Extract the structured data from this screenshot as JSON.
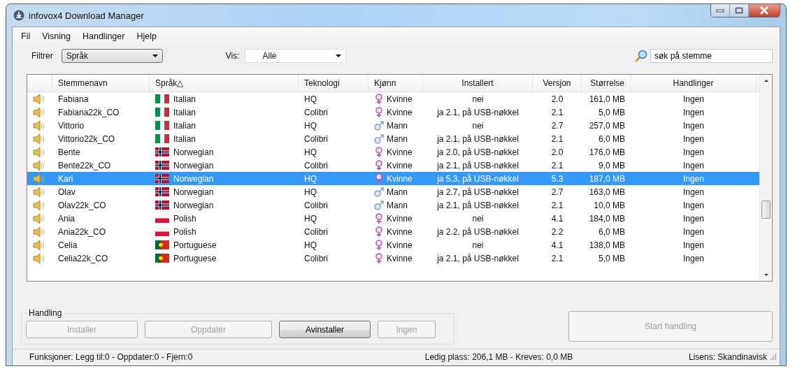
{
  "window": {
    "title": "infovox4 Download Manager"
  },
  "menu": [
    "Fil",
    "Visning",
    "Handlinger",
    "Hjelp"
  ],
  "filter": {
    "label": "Filtrer",
    "value": "Språk"
  },
  "show": {
    "label": "Vis:",
    "value": "Alle"
  },
  "search": {
    "value": "søk på stemme"
  },
  "table": {
    "columns": [
      {
        "label": "Stemmenavn"
      },
      {
        "label": "Språk",
        "sort_mark": "△"
      },
      {
        "label": "Teknologi"
      },
      {
        "label": "Kjønn"
      },
      {
        "label": "Installert"
      },
      {
        "label": "Versjon"
      },
      {
        "label": "Størrelse"
      },
      {
        "label": "Handlinger"
      }
    ],
    "rows": [
      {
        "name": "Fabiana",
        "language": {
          "name": "Italian",
          "kind": "italy"
        },
        "technology": "HQ",
        "gender": {
          "name": "Kvinne",
          "kind": "female"
        },
        "installed": "nei",
        "version": "2.0",
        "size": "161,0 MB",
        "action": "Ingen",
        "selected": false
      },
      {
        "name": "Fabiana22k_CO",
        "language": {
          "name": "Italian",
          "kind": "italy"
        },
        "technology": "Colibri",
        "gender": {
          "name": "Kvinne",
          "kind": "female"
        },
        "installed": "ja 2.1, på USB-nøkkel",
        "version": "2.1",
        "size": "5,0 MB",
        "action": "Ingen",
        "selected": false
      },
      {
        "name": "Vittorio",
        "language": {
          "name": "Italian",
          "kind": "italy"
        },
        "technology": "HQ",
        "gender": {
          "name": "Mann",
          "kind": "male"
        },
        "installed": "nei",
        "version": "2.7",
        "size": "257,0 MB",
        "action": "Ingen",
        "selected": false
      },
      {
        "name": "Vittorio22k_CO",
        "language": {
          "name": "Italian",
          "kind": "italy"
        },
        "technology": "Colibri",
        "gender": {
          "name": "Mann",
          "kind": "male"
        },
        "installed": "ja 2.1, på USB-nøkkel",
        "version": "2.1",
        "size": "6,0 MB",
        "action": "Ingen",
        "selected": false
      },
      {
        "name": "Bente",
        "language": {
          "name": "Norwegian",
          "kind": "norway"
        },
        "technology": "HQ",
        "gender": {
          "name": "Kvinne",
          "kind": "female"
        },
        "installed": "ja 2.0, på USB-nøkkel",
        "version": "2.0",
        "size": "176,0 MB",
        "action": "Ingen",
        "selected": false
      },
      {
        "name": "Bente22k_CO",
        "language": {
          "name": "Norwegian",
          "kind": "norway"
        },
        "technology": "Colibri",
        "gender": {
          "name": "Kvinne",
          "kind": "female"
        },
        "installed": "ja 2.1, på USB-nøkkel",
        "version": "2.1",
        "size": "9,0 MB",
        "action": "Ingen",
        "selected": false
      },
      {
        "name": "Kari",
        "language": {
          "name": "Norwegian",
          "kind": "norway"
        },
        "technology": "HQ",
        "gender": {
          "name": "Kvinne",
          "kind": "female"
        },
        "installed": "ja 5.3, på USB-nøkkel",
        "version": "5.3",
        "size": "187,0 MB",
        "action": "Ingen",
        "selected": true
      },
      {
        "name": "Olav",
        "language": {
          "name": "Norwegian",
          "kind": "norway"
        },
        "technology": "HQ",
        "gender": {
          "name": "Mann",
          "kind": "male"
        },
        "installed": "ja 2.7, på USB-nøkkel",
        "version": "2.7",
        "size": "163,0 MB",
        "action": "Ingen",
        "selected": false
      },
      {
        "name": "Olav22k_CO",
        "language": {
          "name": "Norwegian",
          "kind": "norway"
        },
        "technology": "Colibri",
        "gender": {
          "name": "Mann",
          "kind": "male"
        },
        "installed": "ja 2.1, på USB-nøkkel",
        "version": "2.1",
        "size": "10,0 MB",
        "action": "Ingen",
        "selected": false
      },
      {
        "name": "Ania",
        "language": {
          "name": "Polish",
          "kind": "poland"
        },
        "technology": "HQ",
        "gender": {
          "name": "Kvinne",
          "kind": "female"
        },
        "installed": "nei",
        "version": "4.1",
        "size": "184,0 MB",
        "action": "Ingen",
        "selected": false
      },
      {
        "name": "Ania22k_CO",
        "language": {
          "name": "Polish",
          "kind": "poland"
        },
        "technology": "Colibri",
        "gender": {
          "name": "Kvinne",
          "kind": "female"
        },
        "installed": "ja 2.2, på USB-nøkkel",
        "version": "2.2",
        "size": "6,0 MB",
        "action": "Ingen",
        "selected": false
      },
      {
        "name": "Celia",
        "language": {
          "name": "Portuguese",
          "kind": "portugal"
        },
        "technology": "HQ",
        "gender": {
          "name": "Kvinne",
          "kind": "female"
        },
        "installed": "nei",
        "version": "4.1",
        "size": "138,0 MB",
        "action": "Ingen",
        "selected": false
      },
      {
        "name": "Celia22k_CO",
        "language": {
          "name": "Portuguese",
          "kind": "portugal"
        },
        "technology": "Colibri",
        "gender": {
          "name": "Kvinne",
          "kind": "female"
        },
        "installed": "ja 2.1, på USB-nøkkel",
        "version": "2.1",
        "size": "5,0 MB",
        "action": "Ingen",
        "selected": false
      }
    ]
  },
  "action_group": {
    "title": "Handling",
    "buttons": [
      {
        "label": "Installer",
        "disabled": true
      },
      {
        "label": "Oppdater",
        "disabled": true
      },
      {
        "label": "Avinstaller",
        "disabled": false
      },
      {
        "label": "Ingen",
        "disabled": true
      }
    ]
  },
  "start_button": {
    "label": "Start handling",
    "disabled": true
  },
  "status_bar": {
    "functions": "Funksjoner: Legg til:0 - Oppdater:0 - Fjern:0",
    "space": "Ledig plass: 206,1 MB - Kreves: 0,0 MB",
    "license": "Lisens: Skandinavisk"
  }
}
